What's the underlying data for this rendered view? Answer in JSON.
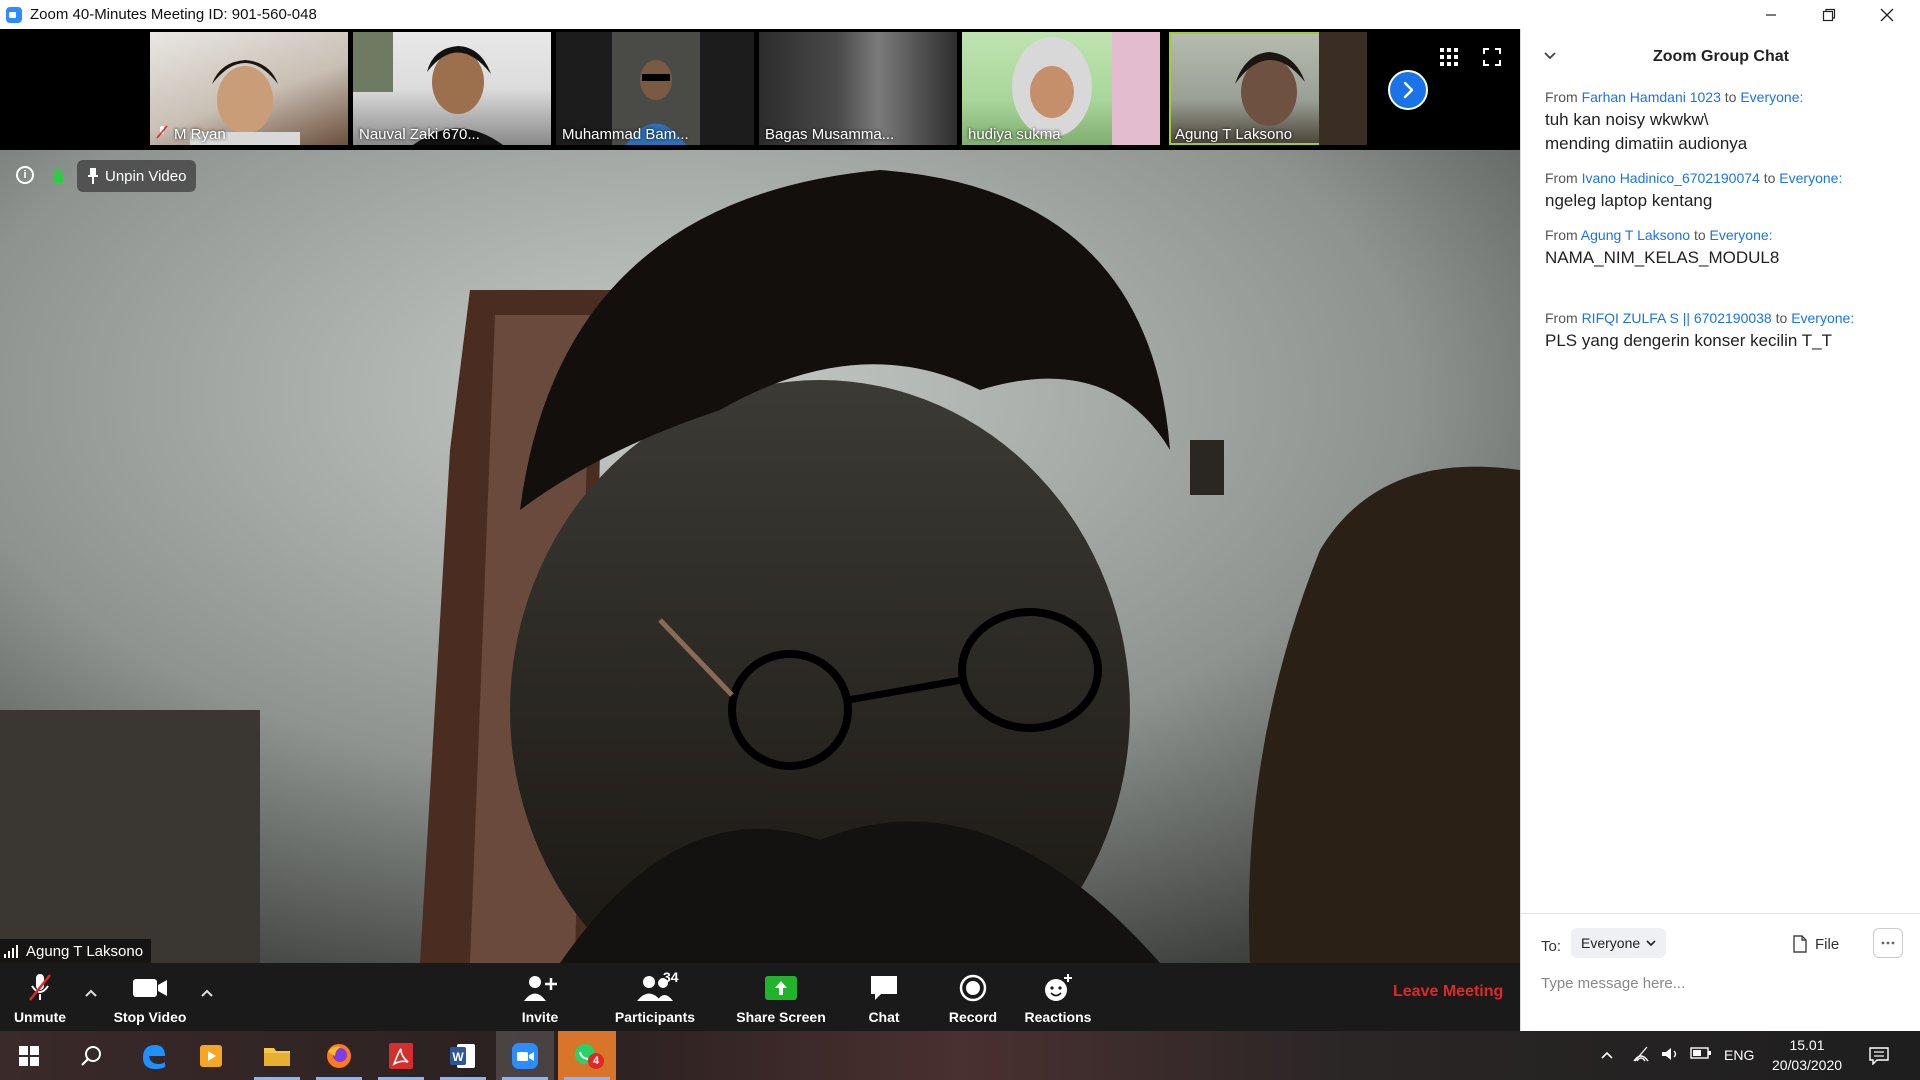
{
  "window": {
    "title": "Zoom 40-Minutes Meeting ID: 901-560-048"
  },
  "participants_strip": [
    {
      "name": "M Ryan",
      "muted": true
    },
    {
      "name": "Nauval Zaki 670...",
      "muted": false
    },
    {
      "name": "Muhammad Bam...",
      "muted": false
    },
    {
      "name": "Bagas Musamma...",
      "muted": false
    },
    {
      "name": "hudiya sukma",
      "muted": false
    },
    {
      "name": "Agung T Laksono",
      "muted": false,
      "active": true
    }
  ],
  "main_video": {
    "unpin_label": "Unpin Video",
    "speaker_name": "Agung T Laksono"
  },
  "toolbar": {
    "unmute": "Unmute",
    "stop_video": "Stop Video",
    "invite": "Invite",
    "participants": "Participants",
    "participants_count": "34",
    "share_screen": "Share Screen",
    "chat": "Chat",
    "record": "Record",
    "reactions": "Reactions",
    "leave": "Leave Meeting"
  },
  "chat": {
    "title": "Zoom Group Chat",
    "messages": [
      {
        "from_prefix": "From",
        "sender": "Farhan Hamdani 1023",
        "to_prefix": "to",
        "recipient": "Everyone:",
        "lines": [
          "tuh kan noisy wkwkw\\",
          "mending dimatiin audionya"
        ]
      },
      {
        "from_prefix": "From",
        "sender": "Ivano Hadinico_6702190074",
        "to_prefix": "to",
        "recipient": "Everyone:",
        "lines": [
          "ngeleg laptop kentang"
        ]
      },
      {
        "from_prefix": "From",
        "sender": "Agung T Laksono",
        "to_prefix": "to",
        "recipient": "Everyone:",
        "lines": [
          "NAMA_NIM_KELAS_MODUL8"
        ]
      },
      {
        "from_prefix": "From",
        "sender": "RIFQI ZULFA S || 6702190038",
        "to_prefix": "to",
        "recipient": "Everyone:",
        "lines": [
          "PLS yang dengerin konser kecilin T_T"
        ]
      }
    ],
    "to_label": "To:",
    "to_value": "Everyone",
    "file_label": "File",
    "input_placeholder": "Type message here..."
  },
  "taskbar": {
    "language": "ENG",
    "time": "15.01",
    "date": "20/03/2020",
    "whatsapp_badge": "4",
    "apps": [
      "windows-start-icon",
      "search-icon",
      "edge-icon",
      "media-player-icon",
      "file-explorer-icon",
      "firefox-icon",
      "acrobat-icon",
      "word-icon",
      "zoom-icon",
      "whatsapp-icon"
    ]
  },
  "colors": {
    "zoom_blue": "#2D8CFF",
    "link_blue": "#1a73e8",
    "leave_red": "#e02828",
    "share_green": "#21b32a",
    "toolbar_bg": "#1a1a1a"
  }
}
